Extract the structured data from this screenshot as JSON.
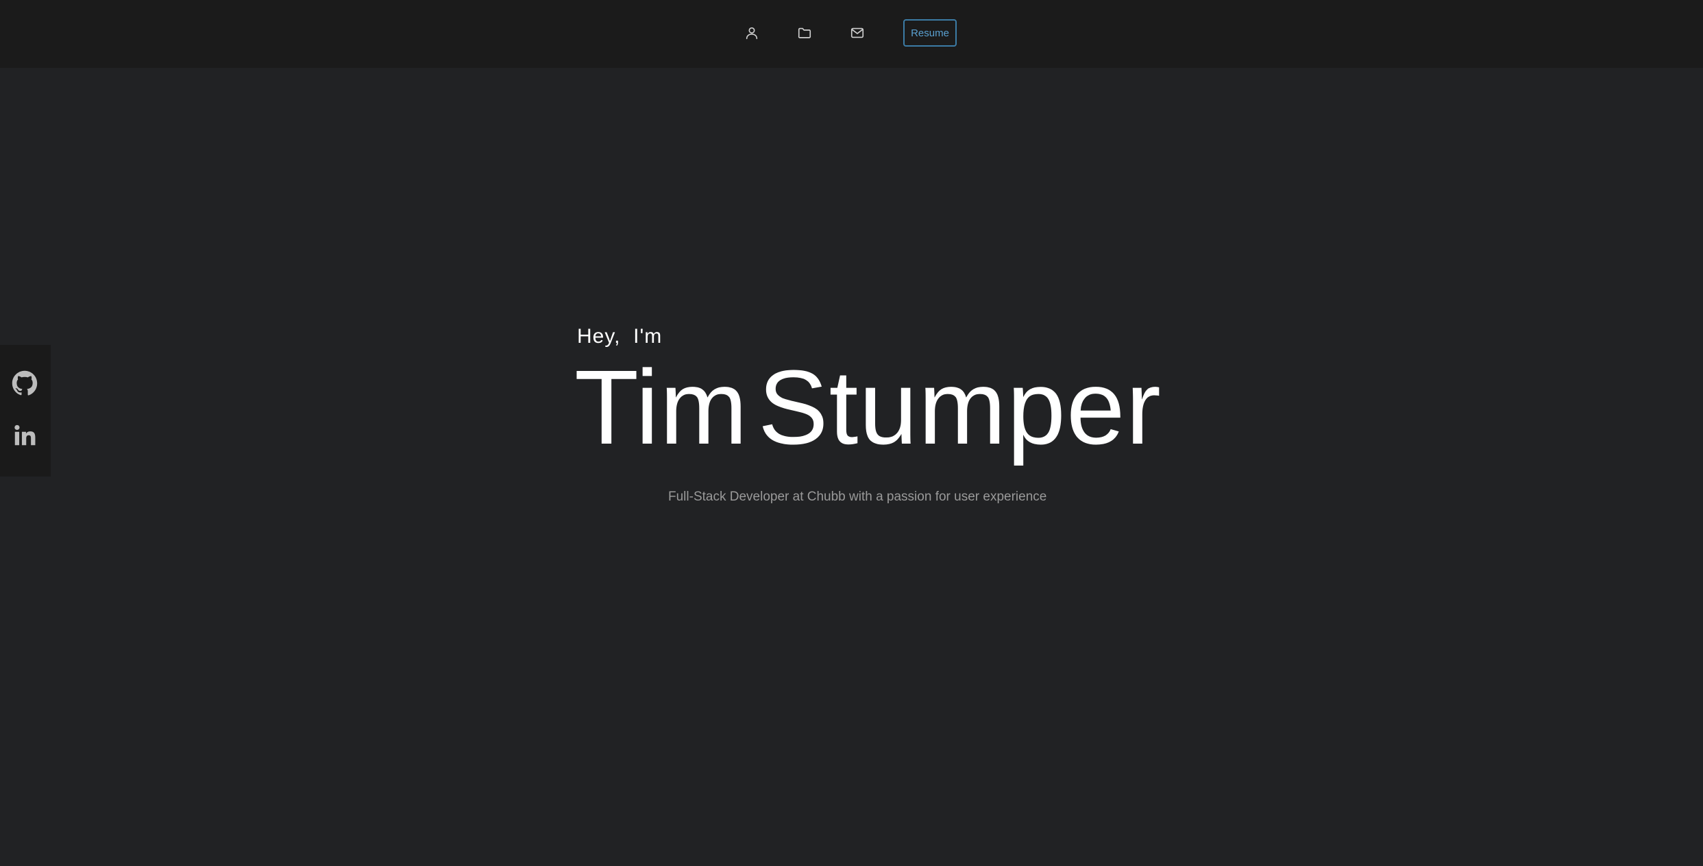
{
  "nav": {
    "icons": [
      "user-icon",
      "folder-icon",
      "mail-icon"
    ],
    "resume_label": "Resume",
    "accent_color": "#3c7ca6"
  },
  "social": {
    "icons": [
      "github-icon",
      "linkedin-icon"
    ]
  },
  "hero": {
    "greeting": "Hey,  I'm",
    "first_name": "Tim",
    "last_name": "Stumper",
    "tagline": "Full-Stack Developer at Chubb with a passion for user experience"
  },
  "colors": {
    "background": "#212224",
    "topbar": "#1b1b1b",
    "text": "#ffffff",
    "muted": "#9a9a9a"
  }
}
